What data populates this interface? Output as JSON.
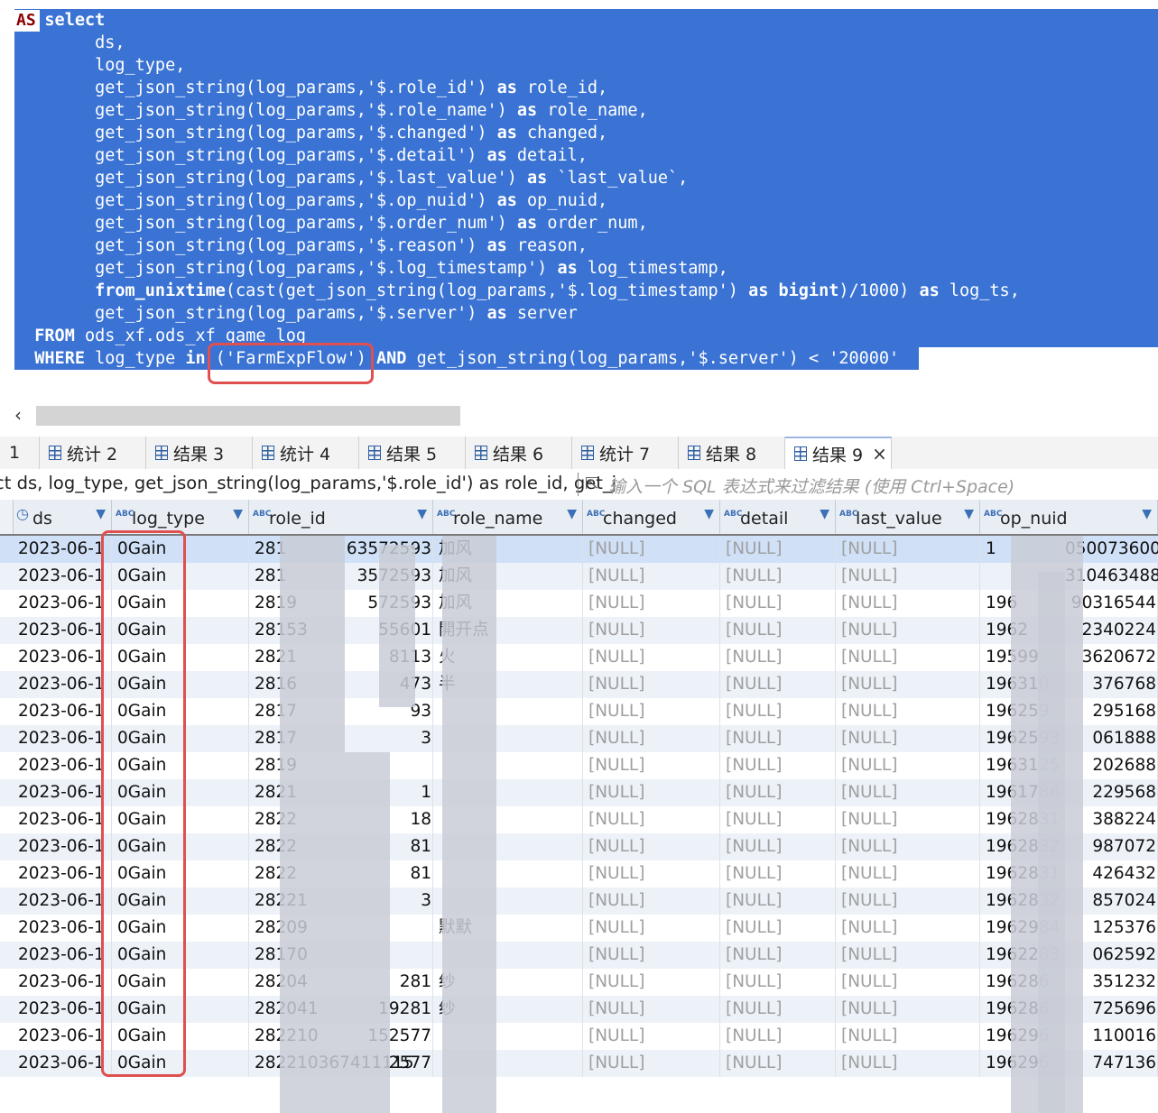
{
  "editor": {
    "as_keyword": "AS",
    "lines": [
      "   select",
      "        ds,",
      "        log_type,",
      "        get_json_string(log_params,'$.role_id') as role_id,",
      "        get_json_string(log_params,'$.role_name') as role_name,",
      "        get_json_string(log_params,'$.changed') as changed,",
      "        get_json_string(log_params,'$.detail') as detail,",
      "        get_json_string(log_params,'$.last_value') as `last_value`,",
      "        get_json_string(log_params,'$.op_nuid') as op_nuid,",
      "        get_json_string(log_params,'$.order_num') as order_num,",
      "        get_json_string(log_params,'$.reason') as reason,",
      "        get_json_string(log_params,'$.log_timestamp') as log_timestamp,",
      "        from_unixtime(cast(get_json_string(log_params,'$.log_timestamp') as bigint)/1000) as log_ts,",
      "        get_json_string(log_params,'$.server') as server",
      "  FROM ods_xf.ods_xf_game_log",
      "  WHERE log_type in ('FarmExpFlow') AND get_json_string(log_params,'$.server') < '20000'"
    ]
  },
  "tabs": [
    {
      "label": "1",
      "icon": "none"
    },
    {
      "label": "统计 2",
      "icon": "grid-icon"
    },
    {
      "label": "结果 3",
      "icon": "grid-icon"
    },
    {
      "label": "统计 4",
      "icon": "grid-icon"
    },
    {
      "label": "结果 5",
      "icon": "grid-icon"
    },
    {
      "label": "结果 6",
      "icon": "grid-icon"
    },
    {
      "label": "统计 7",
      "icon": "grid-icon"
    },
    {
      "label": "结果 8",
      "icon": "grid-icon"
    },
    {
      "label": "结果 9",
      "icon": "grid-icon",
      "active": true
    }
  ],
  "filter": {
    "query_text": "ct ds, log_type, get_json_string(log_params,'$.role_id') as role_id, get_j",
    "placeholder": "输入一个 SQL 表达式来过滤结果 (使用 Ctrl+Space)"
  },
  "columns": [
    "ds",
    "log_type",
    "role_id",
    "role_name",
    "changed",
    "detail",
    "last_value",
    "op_nuid"
  ],
  "rows": [
    [
      "2023-06-1",
      "0Gain",
      "281",
      "63572593",
      "加风",
      "[NULL]",
      "[NULL]",
      "[NULL]",
      "1",
      "0500736000"
    ],
    [
      "2023-06-1",
      "0Gain",
      "281",
      "3572593",
      "加风",
      "[NULL]",
      "[NULL]",
      "[NULL]",
      "",
      "310463488"
    ],
    [
      "2023-06-1",
      "0Gain",
      "2819",
      "572593",
      "加风",
      "[NULL]",
      "[NULL]",
      "[NULL]",
      "196",
      "90316544"
    ],
    [
      "2023-06-1",
      "0Gain",
      "28153",
      "55601",
      "開开点",
      "[NULL]",
      "[NULL]",
      "[NULL]",
      "1962",
      "2340224"
    ],
    [
      "2023-06-1",
      "0Gain",
      "2821",
      "8113",
      "火",
      "[NULL]",
      "[NULL]",
      "[NULL]",
      "19599",
      "3620672"
    ],
    [
      "2023-06-1",
      "0Gain",
      "2816",
      "473",
      "半",
      "[NULL]",
      "[NULL]",
      "[NULL]",
      "196310",
      "376768"
    ],
    [
      "2023-06-1",
      "0Gain",
      "2817",
      "93",
      "",
      "[NULL]",
      "[NULL]",
      "[NULL]",
      "196259",
      "295168"
    ],
    [
      "2023-06-1",
      "0Gain",
      "2817",
      "3",
      "",
      "[NULL]",
      "[NULL]",
      "[NULL]",
      "1962593",
      "061888"
    ],
    [
      "2023-06-1",
      "0Gain",
      "2819",
      "",
      "",
      "[NULL]",
      "[NULL]",
      "[NULL]",
      "1963125",
      "202688"
    ],
    [
      "2023-06-1",
      "0Gain",
      "2821",
      "1",
      "",
      "[NULL]",
      "[NULL]",
      "[NULL]",
      "1961786",
      "229568"
    ],
    [
      "2023-06-1",
      "0Gain",
      "2822",
      "18",
      "",
      "[NULL]",
      "[NULL]",
      "[NULL]",
      "1962831",
      "388224"
    ],
    [
      "2023-06-1",
      "0Gain",
      "2822",
      "81",
      "",
      "[NULL]",
      "[NULL]",
      "[NULL]",
      "1962832",
      "987072"
    ],
    [
      "2023-06-1",
      "0Gain",
      "2822",
      "81",
      "",
      "[NULL]",
      "[NULL]",
      "[NULL]",
      "1962831",
      "426432"
    ],
    [
      "2023-06-1",
      "0Gain",
      "28221",
      "3",
      "",
      "[NULL]",
      "[NULL]",
      "[NULL]",
      "1962832",
      "857024"
    ],
    [
      "2023-06-1",
      "0Gain",
      "28209",
      "",
      "默默",
      "[NULL]",
      "[NULL]",
      "[NULL]",
      "1962984",
      "125376"
    ],
    [
      "2023-06-1",
      "0Gain",
      "28170",
      "",
      "",
      "[NULL]",
      "[NULL]",
      "[NULL]",
      "1962283",
      "062592"
    ],
    [
      "2023-06-1",
      "0Gain",
      "28204",
      "281",
      "纱",
      "[NULL]",
      "[NULL]",
      "[NULL]",
      "196286",
      "351232"
    ],
    [
      "2023-06-1",
      "0Gain",
      "282041",
      "19281",
      "纱",
      "[NULL]",
      "[NULL]",
      "[NULL]",
      "196286",
      "725696"
    ],
    [
      "2023-06-1",
      "0Gain",
      "282210",
      "152577",
      "",
      "[NULL]",
      "[NULL]",
      "[NULL]",
      "196296",
      "110016"
    ],
    [
      "2023-06-1",
      "0Gain",
      "282210367411115",
      "2577",
      "",
      "[NULL]",
      "[NULL]",
      "[NULL]",
      "196296",
      "747136"
    ]
  ]
}
